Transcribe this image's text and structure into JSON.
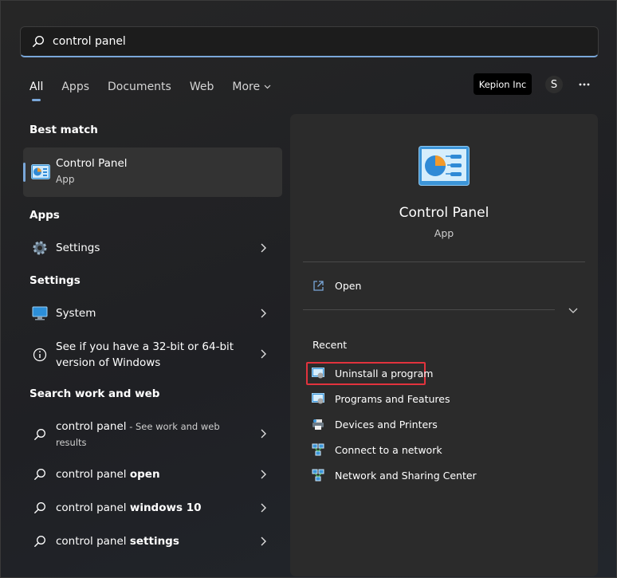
{
  "search": {
    "value": "control panel"
  },
  "tabs": [
    {
      "label": "All",
      "active": true
    },
    {
      "label": "Apps"
    },
    {
      "label": "Documents"
    },
    {
      "label": "Web"
    },
    {
      "label": "More"
    }
  ],
  "header": {
    "org": "Kepion Inc",
    "avatar_initial": "S"
  },
  "sections": {
    "best_match": "Best match",
    "apps": "Apps",
    "settings": "Settings",
    "search_web": "Search work and web"
  },
  "best_match": {
    "title": "Control Panel",
    "subtitle": "App"
  },
  "apps": [
    {
      "label": "Settings"
    }
  ],
  "settings": [
    {
      "label": "System"
    },
    {
      "label_line1": "See if you have a 32-bit or 64-bit",
      "label_line2": "version of Windows"
    }
  ],
  "web": [
    {
      "prefix": "control panel",
      "suffix": " - See work and web",
      "suffix2": "results"
    },
    {
      "prefix": "control panel ",
      "bold": "open"
    },
    {
      "prefix": "control panel ",
      "bold": "windows 10"
    },
    {
      "prefix": "control panel ",
      "bold": "settings"
    }
  ],
  "pane": {
    "title": "Control Panel",
    "subtitle": "App",
    "open": "Open",
    "recent_title": "Recent",
    "recent": [
      "Uninstall a program",
      "Programs and Features",
      "Devices and Printers",
      "Connect to a network",
      "Network and Sharing Center"
    ]
  },
  "colors": {
    "accent": "#7aa7d9",
    "highlight": "#e1333d",
    "pane": "#2b2b2b",
    "card": "#333333"
  }
}
